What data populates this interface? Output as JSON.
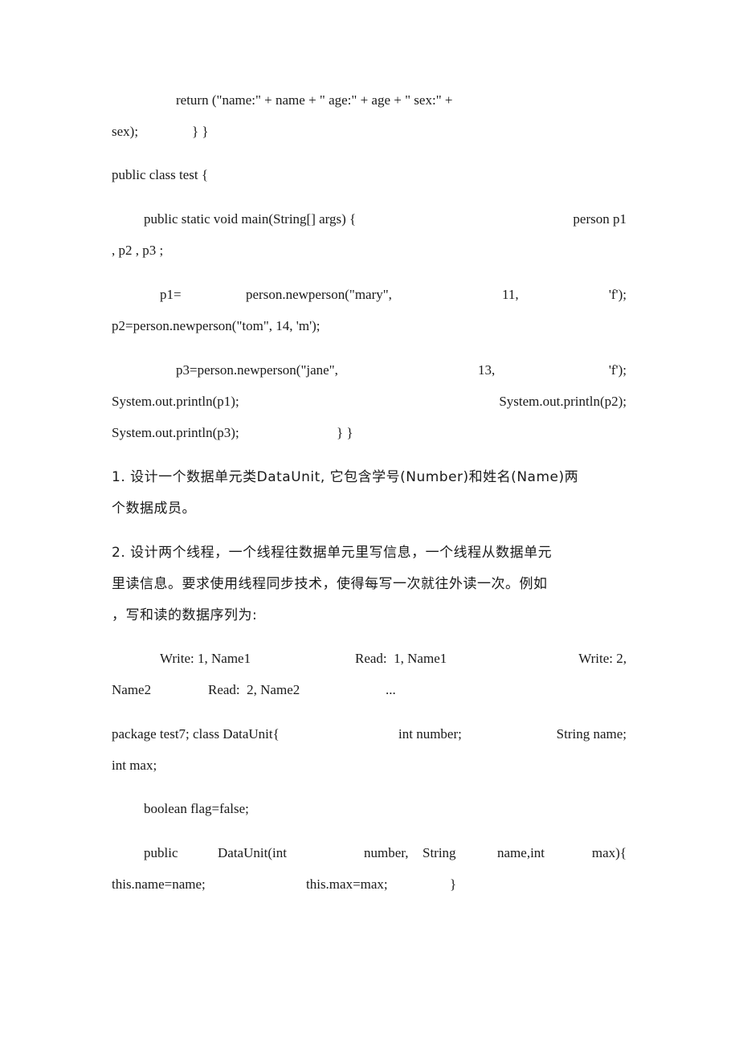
{
  "document": {
    "lines": [
      {
        "segments": [
          "return (\"name:\" + name + \" age:\" + age + \" sex:\" +"
        ]
      },
      {
        "segments": [
          "sex);",
          "} }"
        ]
      },
      {
        "segments": [
          "public class test {"
        ]
      },
      {
        "segments": [
          "public static void main(String[] args) {",
          "person p1"
        ]
      },
      {
        "segments": [
          ", p2 , p3 ;"
        ]
      },
      {
        "segments": [
          "p1=",
          "person.newperson(\"mary\",",
          "11,",
          "'f');"
        ]
      },
      {
        "segments": [
          "p2=person.newperson(\"tom\", 14, 'm');"
        ]
      },
      {
        "segments": [
          "p3=person.newperson(\"jane\",",
          "13,",
          "'f');"
        ]
      },
      {
        "segments": [
          "System.out.println(p1);",
          "System.out.println(p2);"
        ]
      },
      {
        "segments": [
          "System.out.println(p3);",
          "} }"
        ]
      },
      {
        "segments": [
          "1. 设计一个数据单元类DataUnit, 它包含学号(Number)和姓名(Name)两"
        ]
      },
      {
        "segments": [
          "个数据成员。"
        ]
      },
      {
        "segments": [
          "2. 设计两个线程，一个线程往数据单元里写信息，一个线程从数据单元"
        ]
      },
      {
        "segments": [
          "里读信息。要求使用线程同步技术，使得每写一次就往外读一次。例如"
        ]
      },
      {
        "segments": [
          "，写和读的数据序列为:"
        ]
      },
      {
        "segments": [
          "Write: 1, Name1",
          "Read:  1, Name1",
          "Write: 2,"
        ]
      },
      {
        "segments": [
          "Name2",
          "Read:  2, Name2",
          "..."
        ]
      },
      {
        "segments": [
          "package test7; class DataUnit{",
          "int number;",
          "String name;"
        ]
      },
      {
        "segments": [
          "int max;"
        ]
      },
      {
        "segments": [
          "boolean flag=false;"
        ]
      },
      {
        "segments": [
          "public",
          "DataUnit(int",
          "number,",
          "String",
          "name,int",
          "max){"
        ]
      },
      {
        "segments": [
          "this.name=name;",
          "this.max=max;",
          "}"
        ]
      }
    ]
  }
}
